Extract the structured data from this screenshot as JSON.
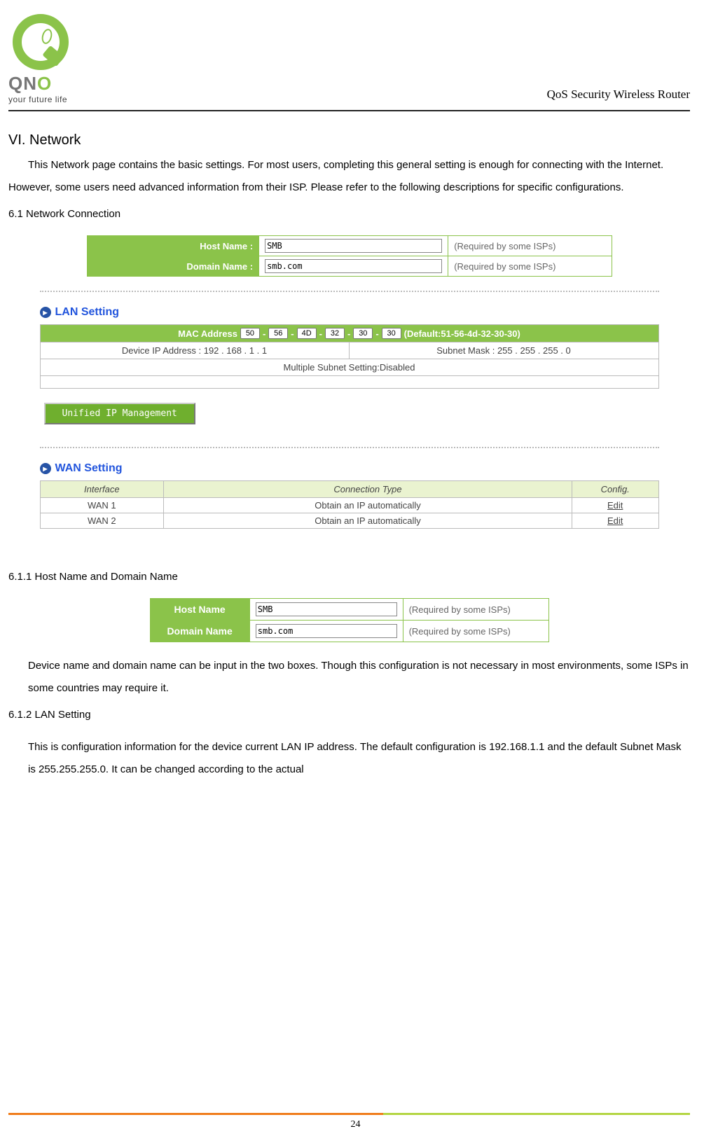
{
  "brand": {
    "name_part1": "QN",
    "name_o": "O",
    "tagline": "your future life"
  },
  "header": {
    "title": "QoS Security Wireless Router"
  },
  "section": {
    "title": "VI.  Network",
    "intro": "This Network page contains the basic settings. For most users, completing this general setting is enough for connecting with the Internet. However, some users need advanced information from their ISP. Please refer to the following descriptions for specific configurations.",
    "sub_6_1": "6.1 Network Connection",
    "sub_6_1_1": "6.1.1 Host Name and Domain Name",
    "para_6_1_1": "Device name and domain name can be input in the two boxes. Though this configuration is not necessary in most environments, some ISPs in some countries may require it.",
    "sub_6_1_2": "6.1.2 LAN Setting",
    "para_6_1_2": "This is configuration information for the device current LAN IP address. The default configuration is 192.168.1.1 and the default Subnet Mask is 255.255.255.0. It can be changed according to the actual"
  },
  "hostdomain": {
    "host_label": "Host Name :",
    "domain_label": "Domain Name :",
    "host_value": "SMB",
    "domain_value": "smb.com",
    "note": "(Required by some ISPs)"
  },
  "hostdomain2": {
    "host_label": "Host Name",
    "domain_label": "Domain Name",
    "host_value": "SMB",
    "domain_value": "smb.com",
    "note": "(Required by some ISPs)"
  },
  "lan": {
    "title": "LAN Setting",
    "mac_label": "MAC Address",
    "mac_parts": [
      "50",
      "56",
      "4D",
      "32",
      "30",
      "30"
    ],
    "mac_default": "(Default:51-56-4d-32-30-30)",
    "device_ip": "Device IP Address : 192 . 168 . 1 . 1",
    "subnet": "Subnet Mask : 255 . 255  . 255 . 0",
    "multi": "Multiple Subnet Setting:Disabled",
    "unified_btn": "Unified IP Management"
  },
  "wan": {
    "title": "WAN Setting",
    "cols": {
      "iface": "Interface",
      "conn": "Connection Type",
      "cfg": "Config."
    },
    "rows": [
      {
        "iface": "WAN 1",
        "conn": "Obtain an IP automatically",
        "cfg": "Edit"
      },
      {
        "iface": "WAN 2",
        "conn": "Obtain an IP automatically",
        "cfg": "Edit"
      }
    ]
  },
  "page_number": "24"
}
